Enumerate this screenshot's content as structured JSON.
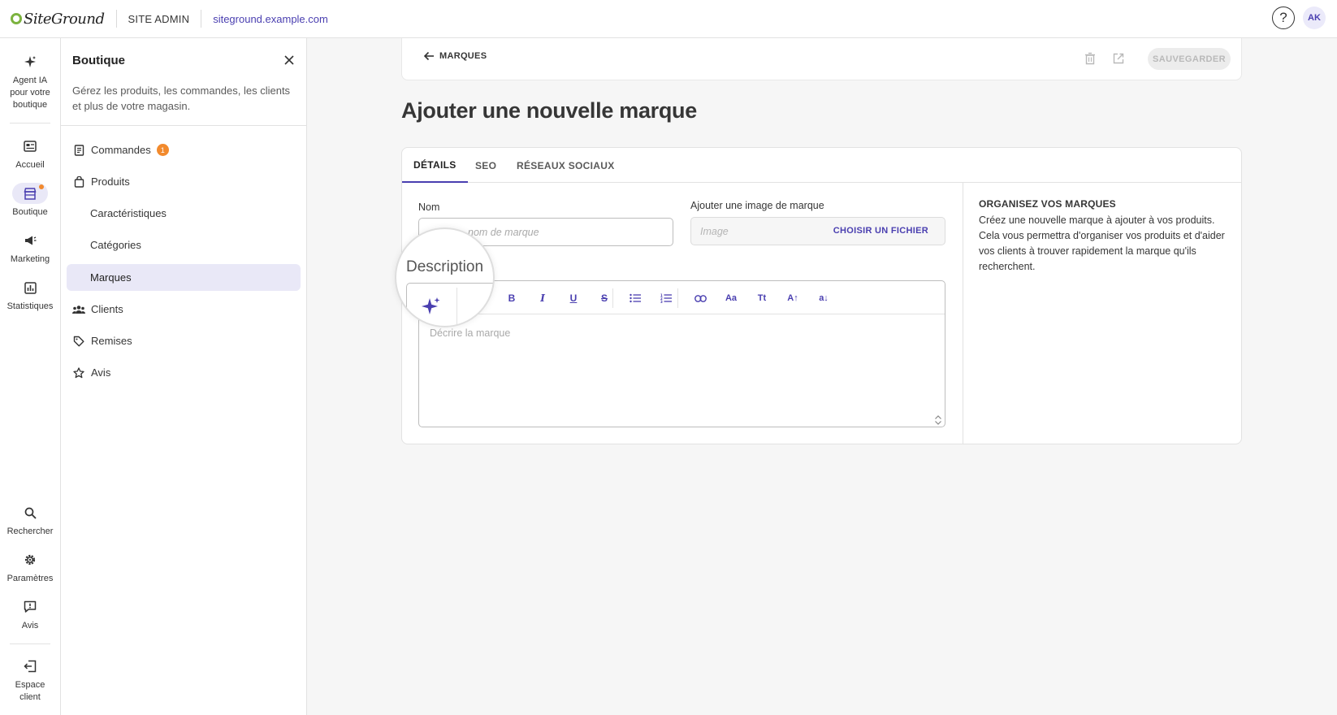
{
  "topbar": {
    "logo_text": "SiteGround",
    "site_admin": "SITE ADMIN",
    "domain": "siteground.example.com",
    "help_glyph": "?",
    "avatar_initials": "AK"
  },
  "rail": {
    "items": [
      {
        "label": "Agent IA pour votre boutique",
        "icon": "ai-sparkle-icon"
      },
      {
        "label": "Accueil",
        "icon": "dashboard-icon"
      },
      {
        "label": "Boutique",
        "icon": "store-icon"
      },
      {
        "label": "Marketing",
        "icon": "megaphone-icon"
      },
      {
        "label": "Statistiques",
        "icon": "chart-icon"
      },
      {
        "label": "Rechercher",
        "icon": "search-icon"
      },
      {
        "label": "Paramètres",
        "icon": "gear-icon"
      },
      {
        "label": "Avis",
        "icon": "feedback-icon"
      },
      {
        "label": "Espace client",
        "icon": "exit-icon"
      }
    ]
  },
  "panel": {
    "title": "Boutique",
    "description": "Gérez les produits, les commandes, les clients et plus de votre magasin.",
    "nav": [
      {
        "label": "Commandes",
        "badge": "1"
      },
      {
        "label": "Produits"
      },
      {
        "label": "Caractéristiques"
      },
      {
        "label": "Catégories"
      },
      {
        "label": "Marques"
      },
      {
        "label": "Clients"
      },
      {
        "label": "Remises"
      },
      {
        "label": "Avis"
      }
    ]
  },
  "actionbar": {
    "back_label": "MARQUES",
    "save_label": "SAUVEGARDER"
  },
  "page": {
    "title": "Ajouter une nouvelle marque"
  },
  "tabs": [
    {
      "label": "DÉTAILS"
    },
    {
      "label": "SEO"
    },
    {
      "label": "RÉSEAUX SOCIAUX"
    }
  ],
  "form": {
    "name_label": "Nom",
    "name_placeholder": "nom de marque",
    "image_label": "Ajouter une image de marque",
    "image_placeholder": "Image",
    "choose_file": "CHOISIR UN FICHIER",
    "description_label": "Description",
    "description_placeholder": "Décrire la marque"
  },
  "toolbar": {
    "text_color": "Aa",
    "text_style": "Tt",
    "uppercase": "A↑",
    "lowercase": "a↓",
    "bold": "B",
    "italic": "I",
    "underline": "U",
    "strike": "S"
  },
  "sidebar_help": {
    "title": "ORGANISEZ VOS MARQUES",
    "text": "Créez une nouvelle marque à ajouter à vos produits. Cela vous permettra d'organiser vos produits et d'aider vos clients à trouver rapidement la marque qu'ils recherchent."
  },
  "colors": {
    "accent": "#4a3fb0",
    "badge": "#f28a2d",
    "active_bg": "#e9e8f7"
  }
}
